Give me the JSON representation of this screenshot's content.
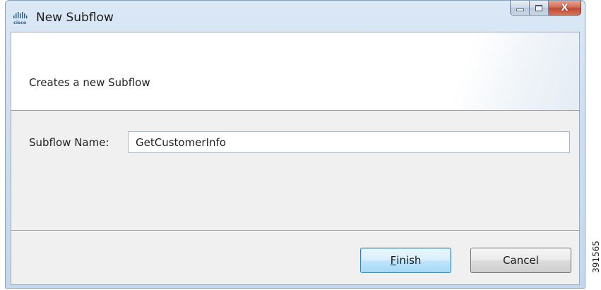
{
  "window": {
    "title": "New Subflow",
    "app_icon": "cisco-logo-icon",
    "caption_buttons": {
      "minimize": "minimize-icon",
      "maximize": "maximize-icon",
      "close_glyph": "X"
    }
  },
  "banner": {
    "description": "Creates a new Subflow"
  },
  "form": {
    "subflow_name_label": "Subflow Name:",
    "subflow_name_value": "GetCustomerInfo"
  },
  "buttons": {
    "finish_accel": "F",
    "finish_rest": "inish",
    "cancel": "Cancel"
  },
  "figure_id": "391565",
  "colors": {
    "close_button": "#c9573f",
    "default_button_border": "#3c7fb1",
    "frame": "#cfdff0"
  }
}
